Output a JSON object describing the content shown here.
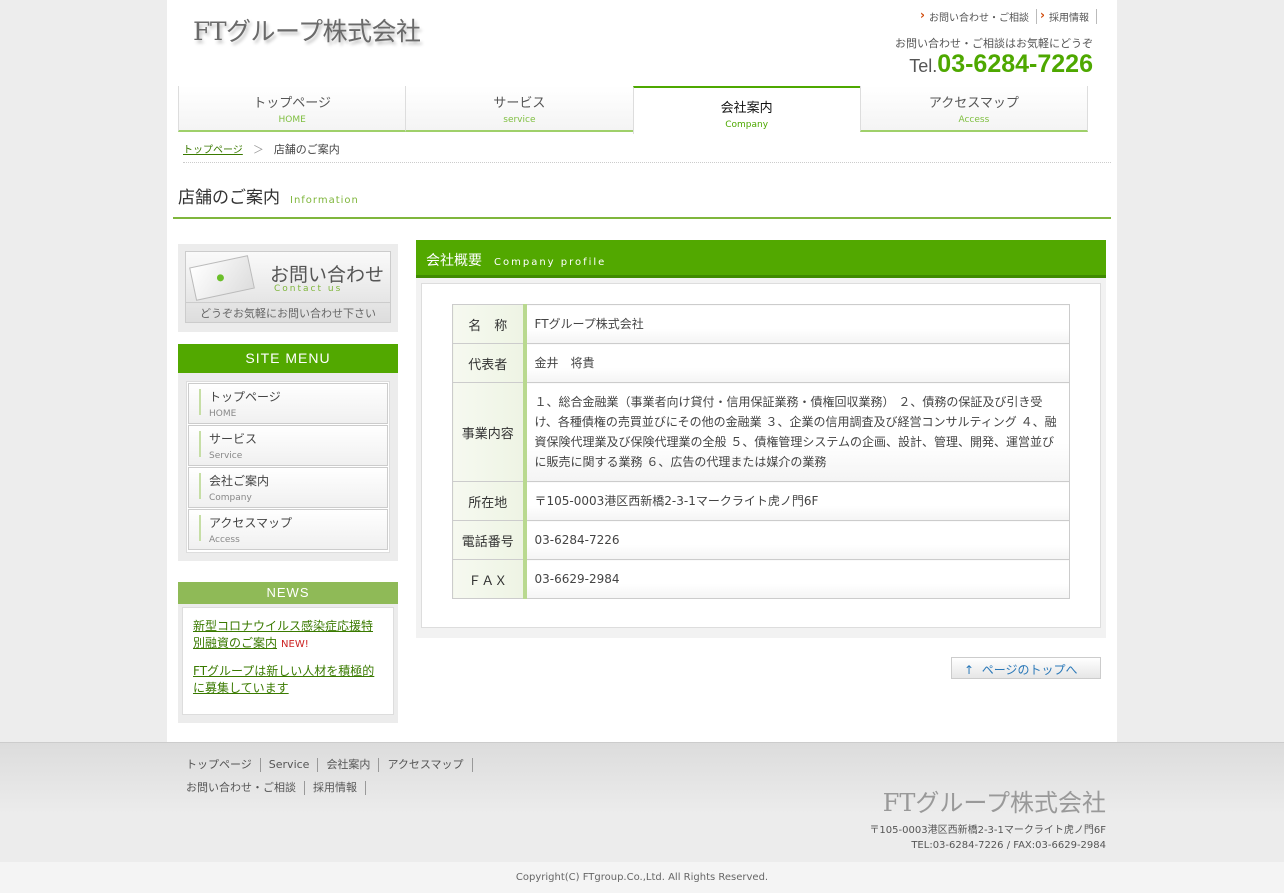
{
  "header": {
    "logo": "FTグループ株式会社",
    "links": [
      "お問い合わせ・ご相談",
      "採用情報"
    ],
    "tagline": "お問い合わせ・ご相談はお気軽にどうぞ",
    "tel_prefix": "Tel.",
    "tel_number": "03-6284-7226"
  },
  "nav": [
    {
      "jp": "トップページ",
      "en": "HOME"
    },
    {
      "jp": "サービス",
      "en": "service"
    },
    {
      "jp": "会社案内",
      "en": "Company"
    },
    {
      "jp": "アクセスマップ",
      "en": "Access"
    }
  ],
  "breadcrumb": {
    "home": "トップページ",
    "sep": "＞",
    "current": "店舗のご案内"
  },
  "page_title": {
    "jp": "店舗のご案内",
    "en": "Information"
  },
  "sidebar": {
    "contact": {
      "title": "お問い合わせ",
      "subtitle": "Contact us",
      "note": "どうぞお気軽にお問い合わせ下さい"
    },
    "menu_title": "SITE MENU",
    "menu": [
      {
        "jp": "トップページ",
        "en": "HOME"
      },
      {
        "jp": "サービス",
        "en": "Service"
      },
      {
        "jp": "会社ご案内",
        "en": "Company"
      },
      {
        "jp": "アクセスマップ",
        "en": "Access"
      }
    ],
    "news_title": "NEWS",
    "news": [
      {
        "text": "新型コロナウイルス感染症応援特別融資のご案内",
        "badge": "NEW!"
      },
      {
        "text": "FTグループは新しい人材を積極的に募集しています",
        "badge": ""
      }
    ]
  },
  "profile": {
    "title": "会社概要",
    "subtitle": "Company profile",
    "rows": [
      {
        "key": "名　称",
        "value": "FTグループ株式会社"
      },
      {
        "key": "代表者",
        "value": "金井　将貴"
      },
      {
        "key": "事業内容",
        "value": "１、総合金融業（事業者向け貸付・信用保証業務・債権回収業務） ２、債務の保証及び引き受け、各種債権の売買並びにその他の金融業 ３、企業の信用調査及び経営コンサルティング ４、融資保険代理業及び保険代理業の全般 ５、債権管理システムの企画、設計、管理、開発、運営並びに販売に関する業務 ６、広告の代理または媒介の業務"
      },
      {
        "key": "所在地",
        "value": "〒105-0003港区西新橋2-3-1マークライト虎ノ門6F"
      },
      {
        "key": "電話番号",
        "value": "03-6284-7226"
      },
      {
        "key": "ＦＡＸ",
        "value": "03-6629-2984"
      }
    ],
    "pagetop": "ページのトップへ"
  },
  "footer": {
    "nav1": [
      "トップページ",
      "Service",
      "会社案内",
      "アクセスマップ"
    ],
    "nav2": [
      "お問い合わせ・ご相談",
      "採用情報"
    ],
    "logo": "FTグループ株式会社",
    "address": "〒105-0003港区西新橋2-3-1マークライト虎ノ門6F",
    "contact": "TEL:03-6284-7226 / FAX:03-6629-2984",
    "copyright": "Copyright(C) FTgroup.Co.,Ltd. All Rights Reserved."
  }
}
